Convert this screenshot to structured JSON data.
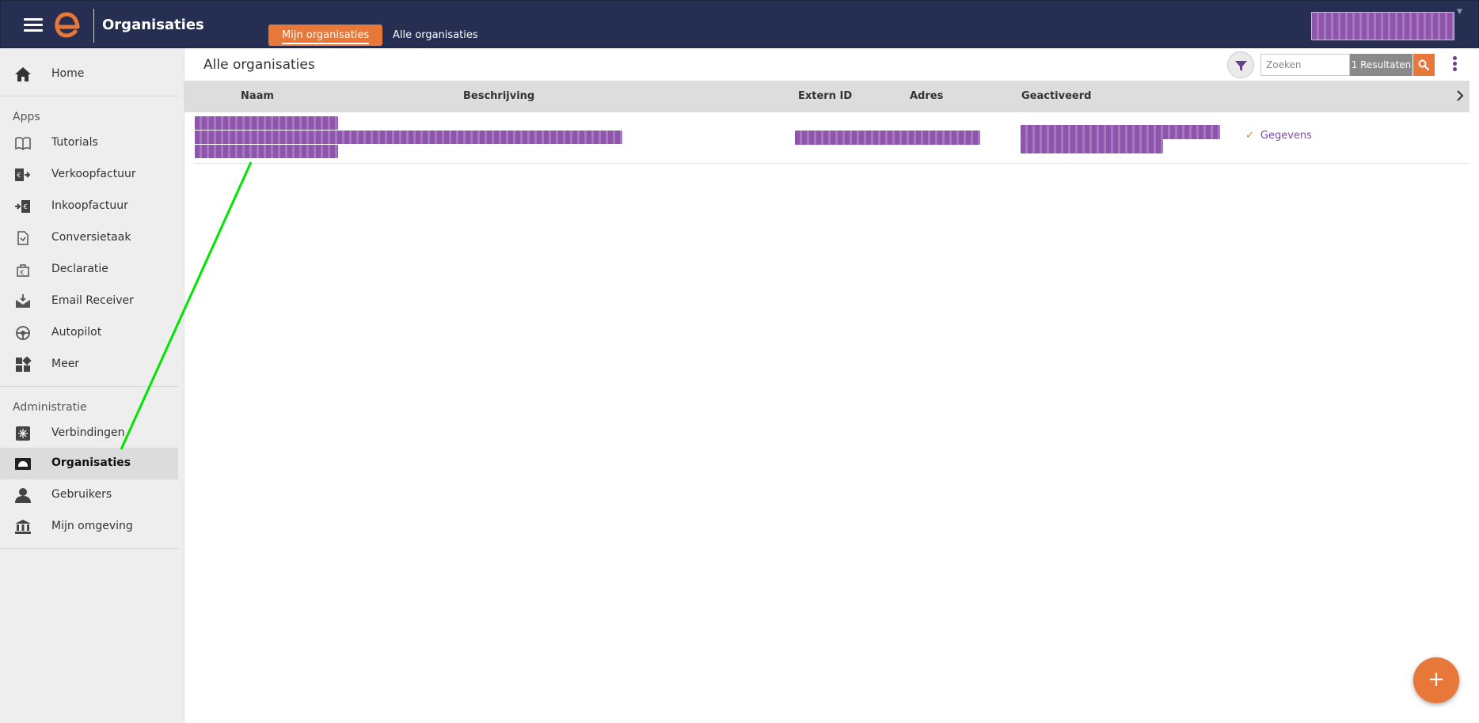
{
  "app": {
    "title": "Organisaties"
  },
  "header_tabs": [
    {
      "label": "Mijn organisaties",
      "active": true
    },
    {
      "label": "Alle organisaties",
      "active": false
    }
  ],
  "sidebar": {
    "home": {
      "label": "Home"
    },
    "apps_section": "Apps",
    "apps": [
      {
        "label": "Tutorials",
        "icon": "book-icon"
      },
      {
        "label": "Verkoopfactuur",
        "icon": "sales-invoice-icon"
      },
      {
        "label": "Inkoopfactuur",
        "icon": "purchase-invoice-icon"
      },
      {
        "label": "Conversietaak",
        "icon": "conversion-icon"
      },
      {
        "label": "Declaratie",
        "icon": "expense-icon"
      },
      {
        "label": "Email Receiver",
        "icon": "email-icon"
      },
      {
        "label": "Autopilot",
        "icon": "autopilot-icon"
      },
      {
        "label": "Meer",
        "icon": "grid-icon"
      }
    ],
    "admin_section": "Administratie",
    "admin": [
      {
        "label": "Verbindingen",
        "icon": "connections-icon"
      },
      {
        "label": "Organisaties",
        "icon": "organisation-icon",
        "active": true
      },
      {
        "label": "Gebruikers",
        "icon": "user-icon"
      },
      {
        "label": "Mijn omgeving",
        "icon": "bank-icon"
      }
    ]
  },
  "main": {
    "title": "Alle organisaties",
    "search": {
      "placeholder": "Zoeken",
      "results": "1 Resultaten"
    },
    "columns": [
      "Naam",
      "Beschrijving",
      "Extern ID",
      "Adres",
      "Geactiveerd"
    ],
    "rows": [
      {
        "action": "Gegevens"
      }
    ]
  },
  "fab": {
    "label": "+"
  },
  "colors": {
    "topbar": "#262f52",
    "accent": "#e8773a",
    "redaction": "#8f55ad",
    "link": "#7b4aa3",
    "annotation": "#00e600"
  }
}
